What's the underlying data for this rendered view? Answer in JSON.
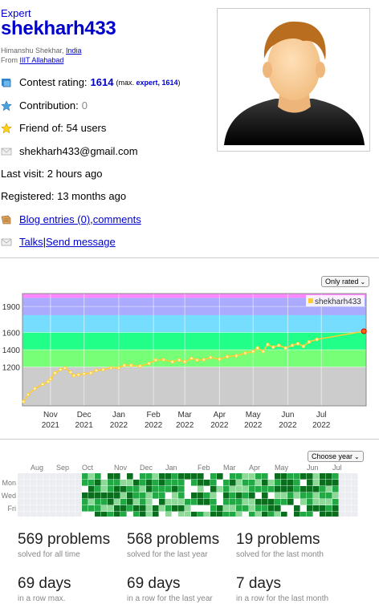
{
  "profile": {
    "rank": "Expert",
    "handle": "shekharh433",
    "name_prefix": "Himanshu Shekhar, ",
    "country": "India",
    "from_prefix": "From ",
    "organization": "IIIT Allahabad"
  },
  "info": {
    "rating_label": "Contest rating:",
    "rating_value": "1614",
    "rating_max_prefix": "(max.",
    "rating_max_rank": "expert, 1614",
    "rating_max_suffix": ")",
    "contribution_label": "Contribution:",
    "contribution_value": "0",
    "friend_of": "Friend of: 54 users",
    "email": "shekharh433@gmail.com",
    "last_visit": "Last visit: 2 hours ago",
    "registered": "Registered: 13 months ago",
    "blog_entries": "Blog entries (0)",
    "blog_sep": ", ",
    "comments": "comments",
    "talks": "Talks",
    "talks_sep": " | ",
    "send_message": "Send message"
  },
  "icons": {
    "rating": "rating-icon",
    "contribution": "contribution-star-icon",
    "friend": "friend-star-icon",
    "email": "envelope-icon",
    "blog": "blog-icon",
    "talks": "talks-envelope-icon"
  },
  "colors": {
    "link": "#0000cc",
    "rating_line": "#ffcc33",
    "band_master": "#ff88ff",
    "band_cm": "#aaaaff",
    "band_expert": "#77ddff",
    "band_specialist": "#22ff88",
    "band_pupil": "#77ff77",
    "band_newbie": "#cccccc",
    "heat_empty": "#ebedf0",
    "heat_dark": "#0b6e1f",
    "heat_mid": "#22a845",
    "heat_light": "#8fd89a"
  },
  "chart_controls": {
    "filter": "Only rated"
  },
  "chart_data": {
    "type": "line",
    "legend": "shekharh433",
    "legend_position": "top-right",
    "y_ticks": [
      1200,
      1400,
      1600,
      1900
    ],
    "x_ticks": [
      {
        "month": "Nov",
        "year": "2021"
      },
      {
        "month": "Dec",
        "year": "2021"
      },
      {
        "month": "Jan",
        "year": "2022"
      },
      {
        "month": "Feb",
        "year": "2022"
      },
      {
        "month": "Mar",
        "year": "2022"
      },
      {
        "month": "Apr",
        "year": "2022"
      },
      {
        "month": "May",
        "year": "2022"
      },
      {
        "month": "Jun",
        "year": "2022"
      },
      {
        "month": "Jul",
        "year": "2022"
      }
    ],
    "ylim": [
      750,
      2050
    ],
    "xlim": [
      "2021-10-07",
      "2022-08-10"
    ],
    "bands": [
      {
        "from": 2050,
        "to": 2000
      },
      {
        "from": 2000,
        "to": 1800
      },
      {
        "from": 1800,
        "to": 1600
      },
      {
        "from": 1600,
        "to": 1400
      },
      {
        "from": 1400,
        "to": 1200
      },
      {
        "from": 1200,
        "to": 750
      }
    ],
    "series": [
      {
        "name": "shekharh433",
        "points": [
          {
            "x": "2021-10-08",
            "y": 800
          },
          {
            "x": "2021-10-12",
            "y": 880
          },
          {
            "x": "2021-10-18",
            "y": 950
          },
          {
            "x": "2021-10-25",
            "y": 1000
          },
          {
            "x": "2021-10-30",
            "y": 1030
          },
          {
            "x": "2021-11-01",
            "y": 1060
          },
          {
            "x": "2021-11-05",
            "y": 1130
          },
          {
            "x": "2021-11-10",
            "y": 1170
          },
          {
            "x": "2021-11-14",
            "y": 1190
          },
          {
            "x": "2021-11-19",
            "y": 1140
          },
          {
            "x": "2021-11-22",
            "y": 1100
          },
          {
            "x": "2021-11-26",
            "y": 1110
          },
          {
            "x": "2021-12-01",
            "y": 1120
          },
          {
            "x": "2021-12-07",
            "y": 1130
          },
          {
            "x": "2021-12-12",
            "y": 1160
          },
          {
            "x": "2021-12-18",
            "y": 1170
          },
          {
            "x": "2021-12-25",
            "y": 1190
          },
          {
            "x": "2022-01-01",
            "y": 1190
          },
          {
            "x": "2022-01-06",
            "y": 1220
          },
          {
            "x": "2022-01-12",
            "y": 1220
          },
          {
            "x": "2022-01-20",
            "y": 1210
          },
          {
            "x": "2022-01-28",
            "y": 1240
          },
          {
            "x": "2022-02-03",
            "y": 1280
          },
          {
            "x": "2022-02-10",
            "y": 1285
          },
          {
            "x": "2022-02-18",
            "y": 1260
          },
          {
            "x": "2022-02-24",
            "y": 1280
          },
          {
            "x": "2022-03-01",
            "y": 1260
          },
          {
            "x": "2022-03-07",
            "y": 1300
          },
          {
            "x": "2022-03-12",
            "y": 1280
          },
          {
            "x": "2022-03-18",
            "y": 1285
          },
          {
            "x": "2022-03-24",
            "y": 1310
          },
          {
            "x": "2022-04-01",
            "y": 1290
          },
          {
            "x": "2022-04-08",
            "y": 1320
          },
          {
            "x": "2022-04-16",
            "y": 1330
          },
          {
            "x": "2022-04-24",
            "y": 1360
          },
          {
            "x": "2022-05-01",
            "y": 1380
          },
          {
            "x": "2022-05-05",
            "y": 1420
          },
          {
            "x": "2022-05-10",
            "y": 1380
          },
          {
            "x": "2022-05-14",
            "y": 1460
          },
          {
            "x": "2022-05-19",
            "y": 1430
          },
          {
            "x": "2022-05-24",
            "y": 1450
          },
          {
            "x": "2022-05-30",
            "y": 1420
          },
          {
            "x": "2022-06-05",
            "y": 1450
          },
          {
            "x": "2022-06-10",
            "y": 1470
          },
          {
            "x": "2022-06-15",
            "y": 1440
          },
          {
            "x": "2022-06-20",
            "y": 1490
          },
          {
            "x": "2022-06-27",
            "y": 1520
          },
          {
            "x": "2022-08-08",
            "y": 1614
          }
        ]
      }
    ]
  },
  "heatmap": {
    "year_select": "Choose year",
    "months": [
      {
        "label": "Aug",
        "week": 2
      },
      {
        "label": "Sep",
        "week": 6
      },
      {
        "label": "Oct",
        "week": 10
      },
      {
        "label": "Nov",
        "week": 15
      },
      {
        "label": "Dec",
        "week": 19
      },
      {
        "label": "Jan",
        "week": 23
      },
      {
        "label": "Feb",
        "week": 28
      },
      {
        "label": "Mar",
        "week": 32
      },
      {
        "label": "Apr",
        "week": 36
      },
      {
        "label": "May",
        "week": 40
      },
      {
        "label": "Jun",
        "week": 45
      },
      {
        "label": "Jul",
        "week": 49
      }
    ],
    "days": [
      {
        "label": "Mon",
        "row": 1
      },
      {
        "label": "Wed",
        "row": 3
      },
      {
        "label": "Fri",
        "row": 5
      }
    ],
    "weeks": 53,
    "active_from_week": 10,
    "active_to_week": 49
  },
  "stats": [
    {
      "big": "569 problems",
      "small": "solved for all time"
    },
    {
      "big": "568 problems",
      "small": "solved for the last year"
    },
    {
      "big": "19 problems",
      "small": "solved for the last month"
    },
    {
      "big": "69 days",
      "small": "in a row max."
    },
    {
      "big": "69 days",
      "small": "in a row for the last year"
    },
    {
      "big": "7 days",
      "small": "in a row for the last month"
    }
  ]
}
